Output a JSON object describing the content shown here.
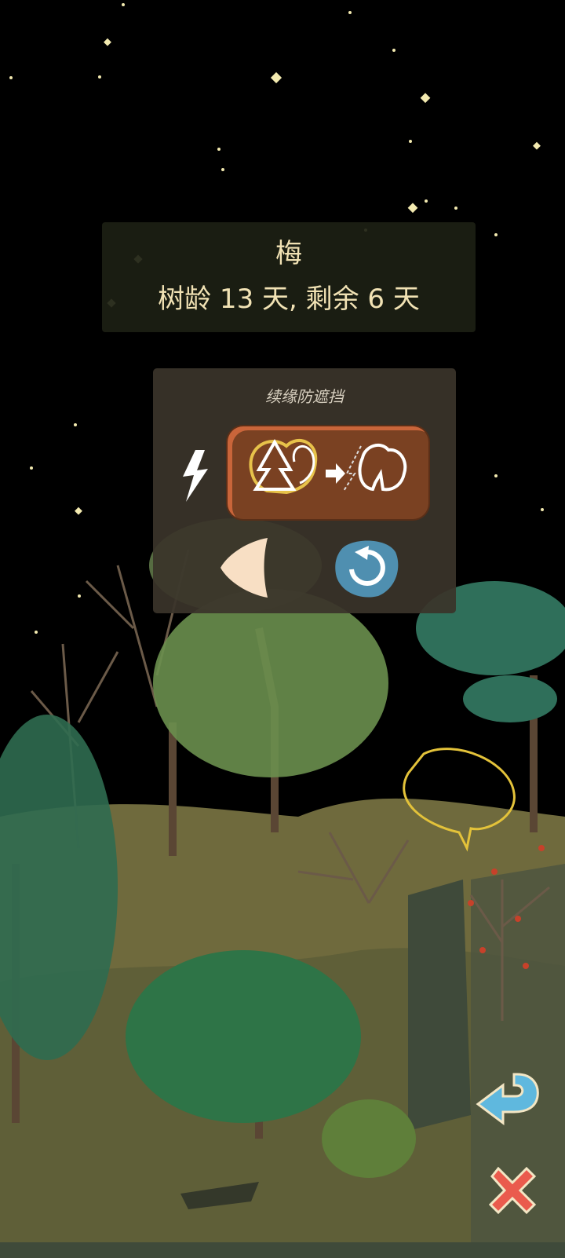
{
  "info": {
    "tree_name": "梅",
    "age_text": "树龄 13 天, 剩余 6 天"
  },
  "control_panel": {
    "title": "续缘防遮挡"
  },
  "icons": {
    "lightning": "lightning-icon",
    "toggle": "tree-transparency-toggle-icon",
    "previous": "triangle-left-icon",
    "reset": "circular-arrow-icon",
    "back": "return-arrow-icon",
    "close": "close-x-icon"
  },
  "colors": {
    "sky": "#000000",
    "panel_text": "#f1e2b4",
    "toggle_bg": "#7a4122",
    "reset_bg": "#4f8fb0",
    "close": "#ea5b4d",
    "back": "#5fb8de"
  }
}
